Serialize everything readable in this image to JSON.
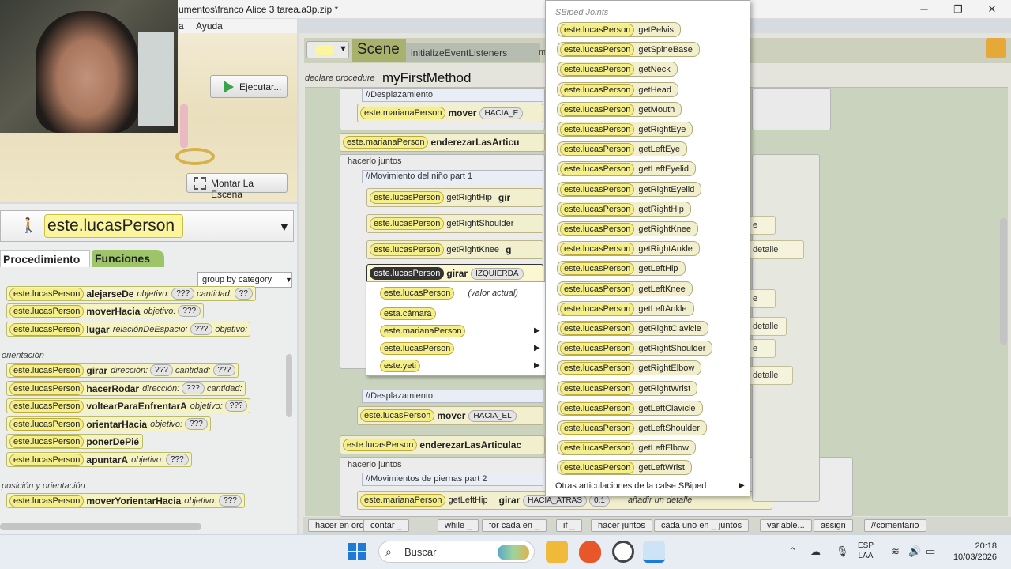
{
  "window": {
    "title": "umentos\\franco Alice 3 tarea.a3p.zip *",
    "minimize": "─",
    "restore": "❐",
    "close": "✕"
  },
  "menu": {
    "items": [
      "a",
      "Ayuda"
    ]
  },
  "scene_controls": {
    "run_label": "Ejecutar...",
    "setup_label": "Montar La Escena"
  },
  "object_selector": {
    "selected": "este.lucasPerson"
  },
  "left_tabs": {
    "procedures": "Procedimiento",
    "functions": "Funciones"
  },
  "group_by": "group by category",
  "sections": {
    "orientation": "orientación",
    "position_orientation": "posición y orientación"
  },
  "procedures": {
    "rows_top": [
      {
        "target": "este.lucasPerson",
        "method": "alejarseDe",
        "params": [
          [
            "objetivo:",
            "???"
          ],
          [
            "cantidad:",
            "??"
          ]
        ]
      },
      {
        "target": "este.lucasPerson",
        "method": "moverHacia",
        "params": [
          [
            "objetivo:",
            "???"
          ]
        ]
      },
      {
        "target": "este.lucasPerson",
        "method": "lugar",
        "params": [
          [
            "relaciónDeEspacio:",
            "???"
          ],
          [
            "objetivo:",
            ""
          ]
        ]
      }
    ],
    "rows_orientation": [
      {
        "target": "este.lucasPerson",
        "method": "girar",
        "params": [
          [
            "dirección:",
            "???"
          ],
          [
            "cantidad:",
            "???"
          ]
        ]
      },
      {
        "target": "este.lucasPerson",
        "method": "hacerRodar",
        "params": [
          [
            "dirección:",
            "???"
          ],
          [
            "cantidad:",
            ""
          ]
        ]
      },
      {
        "target": "este.lucasPerson",
        "method": "voltearParaEnfrentarA",
        "params": [
          [
            "objetivo:",
            "???"
          ]
        ]
      },
      {
        "target": "este.lucasPerson",
        "method": "orientarHacia",
        "params": [
          [
            "objetivo:",
            "???"
          ]
        ]
      },
      {
        "target": "este.lucasPerson",
        "method": "ponerDePié",
        "params": []
      },
      {
        "target": "este.lucasPerson",
        "method": "apuntarA",
        "params": [
          [
            "objetivo:",
            "???"
          ]
        ]
      }
    ],
    "rows_position": [
      {
        "target": "este.lucasPerson",
        "method": "moverYorientarHacia",
        "params": [
          [
            "objetivo:",
            "???"
          ]
        ]
      }
    ]
  },
  "editor": {
    "tab_scene": "Scene",
    "tab_listeners": "initializeEventListeners",
    "tab_partial": "m",
    "declare_label": "declare procedure",
    "procedure_name": "myFirstMethod",
    "comments": {
      "c1": "//Desplazamiento",
      "c2": "//Movimiento del niño part 1",
      "c3": "//Desplazamiento",
      "c4": "//Movimientos de piernas part 2"
    },
    "do_together": "hacerlo juntos",
    "lines": {
      "l1_target": "este.marianaPerson",
      "l1_method": "mover",
      "l1_arg": "HACIA_E",
      "l2_target": "este.marianaPerson",
      "l2_method": "enderezarLasArticu",
      "l3_target": "este.lucasPerson",
      "l3_getter": "getRightHip",
      "l3_method": "gir",
      "l4_target": "este.lucasPerson",
      "l4_getter": "getRightShoulder",
      "l5_target": "este.lucasPerson",
      "l5_getter": "getRightKnee",
      "l5_method": "g",
      "l6_target": "este.lucasPerson",
      "l6_method": "girar",
      "l6_arg": "IZQUIERDA",
      "l7_target": "este.lucasPerson",
      "l7_method": "mover",
      "l7_arg": "HACIA_EL",
      "l8_target": "este.lucasPerson",
      "l8_method": "enderezarLasArticulac",
      "l9_target": "este.marianaPerson",
      "l9_getter": "getLeftHip",
      "l9_method": "girar",
      "l9_arg": "HACIA_ATRAS",
      "l9_amount": "0.1",
      "l9_more": "añadir un detalle"
    },
    "ghost_details": [
      "añadir un detalle",
      "detalle",
      "detalle",
      "detalle"
    ],
    "ghost_partial": [
      "e",
      "e",
      "e"
    ]
  },
  "submenu": {
    "items": [
      {
        "label": "este.lucasPerson",
        "note": "(valor actual)"
      },
      {
        "label": "esta.cámara",
        "note": ""
      },
      {
        "label": "este.marianaPerson",
        "note": ""
      },
      {
        "label": "este.lucasPerson",
        "note": ""
      },
      {
        "label": "este.yeti",
        "note": ""
      }
    ]
  },
  "joints_menu": {
    "title": "SBiped Joints",
    "target": "este.lucasPerson",
    "items": [
      "getPelvis",
      "getSpineBase",
      "getNeck",
      "getHead",
      "getMouth",
      "getRightEye",
      "getLeftEye",
      "getLeftEyelid",
      "getRightEyelid",
      "getRightHip",
      "getRightKnee",
      "getRightAnkle",
      "getLeftHip",
      "getLeftKnee",
      "getLeftAnkle",
      "getRightClavicle",
      "getRightShoulder",
      "getRightElbow",
      "getRightWrist",
      "getLeftClavicle",
      "getLeftShoulder",
      "getLeftElbow",
      "getLeftWrist"
    ],
    "more": "Otras articulaciones de la calse SBiped"
  },
  "bottom_blocks": [
    "hacer en orden",
    "contar _",
    "while _",
    "for cada en _",
    "if _",
    "hacer juntos",
    "cada uno en _ juntos",
    "variable...",
    "assign",
    "//comentario"
  ],
  "taskbar": {
    "search": "Buscar",
    "lang_line1": "ESP",
    "lang_line2": "LAA",
    "time": "20:18",
    "date": "10/03/2026"
  },
  "colors": {
    "pill_yellow": "#f4ef8a",
    "functions_tab": "#9ec46a",
    "scene_tab": "#a9b26d",
    "run_green": "#39a347"
  }
}
